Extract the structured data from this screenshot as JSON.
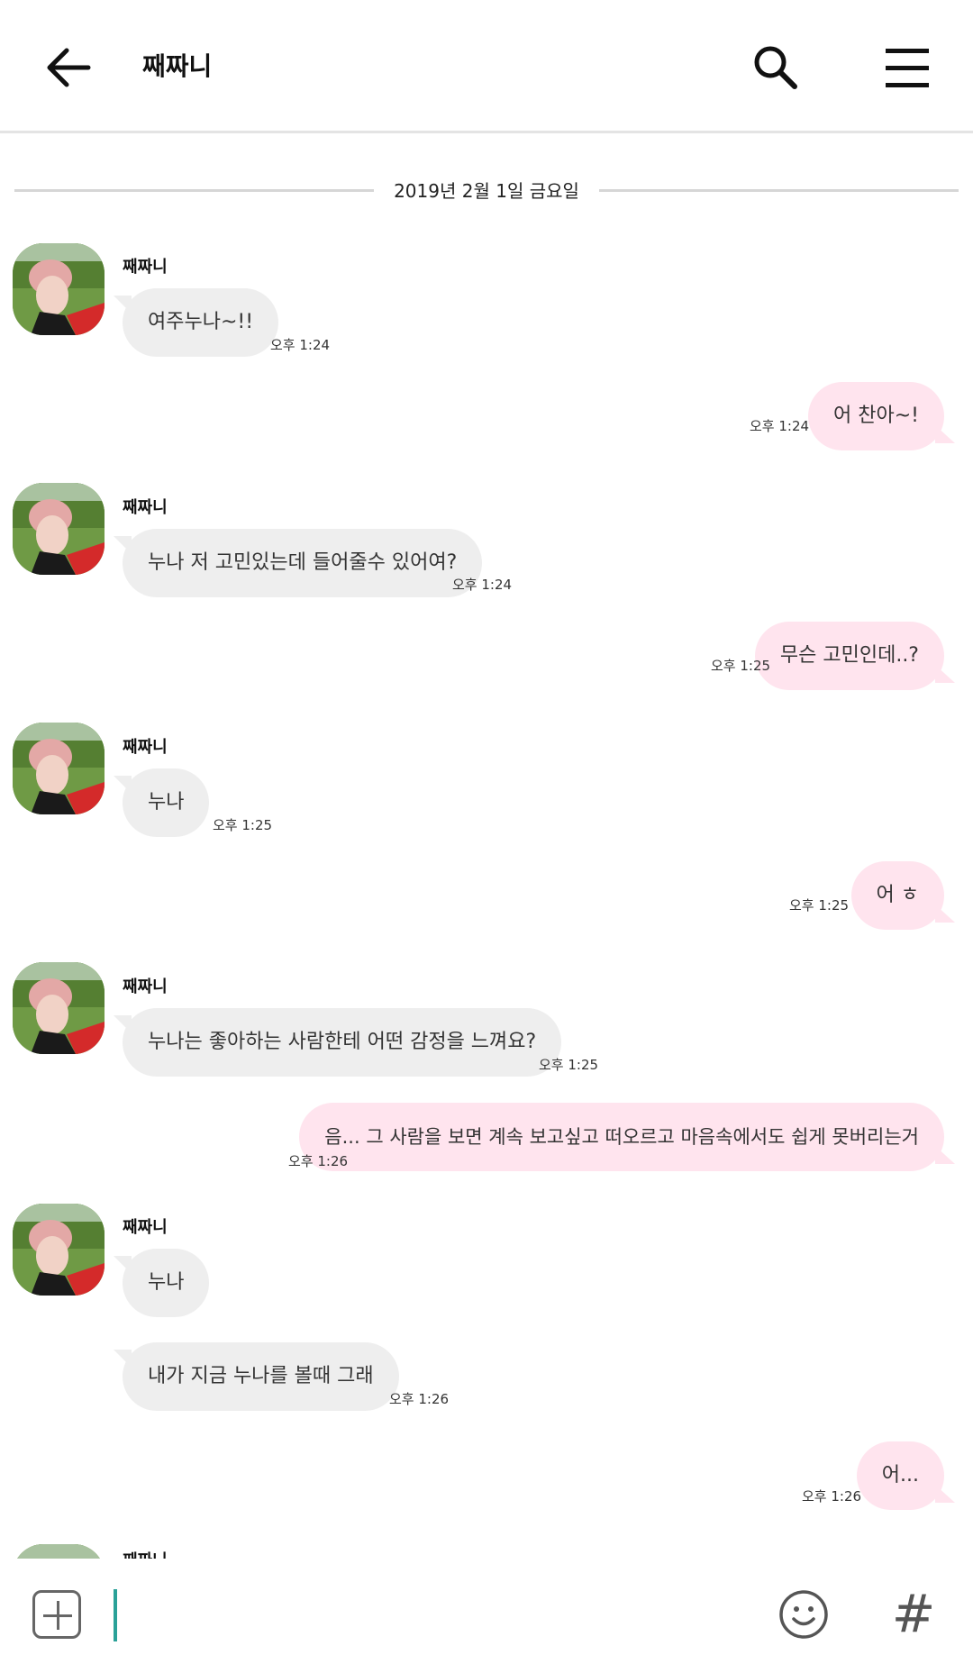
{
  "header": {
    "title": "째짜니"
  },
  "date_divider": "2019년 2월 1일 금요일",
  "contact": {
    "name": "째짜니"
  },
  "messages": [
    {
      "text": "여주누나~!!",
      "time": "오후 1:24"
    },
    {
      "text": "어 찬아~!",
      "time": "오후 1:24"
    },
    {
      "text": "누나 저 고민있는데 들어줄수 있어여?",
      "time": "오후 1:24"
    },
    {
      "text": "무슨 고민인데..?",
      "time": "오후 1:25"
    },
    {
      "text": "누나",
      "time": "오후 1:25"
    },
    {
      "text": "어 ㅎ",
      "time": "오후 1:25"
    },
    {
      "text": "누나는 좋아하는 사람한테 어떤 감정을 느껴요?",
      "time": "오후 1:25"
    },
    {
      "text": "음... 그 사람을 보면 계속 보고싶고 떠오르고 마음속에서도 쉽게 못버리는거",
      "time": "오후 1:26"
    },
    {
      "text": "누나",
      "time": ""
    },
    {
      "text": "내가 지금 누나를 볼때 그래",
      "time": "오후 1:26"
    },
    {
      "text": "어...",
      "time": "오후 1:26"
    }
  ],
  "input": {
    "value": ""
  },
  "icons": {
    "back": "arrow-left-icon",
    "search": "search-icon",
    "menu": "hamburger-menu-icon",
    "attach": "plus-icon",
    "emoji": "smiley-icon",
    "hashtag": "#"
  },
  "colors": {
    "incoming_bubble": "#eeeeee",
    "outgoing_bubble": "#ffe4ee",
    "cursor": "#2aa198"
  }
}
